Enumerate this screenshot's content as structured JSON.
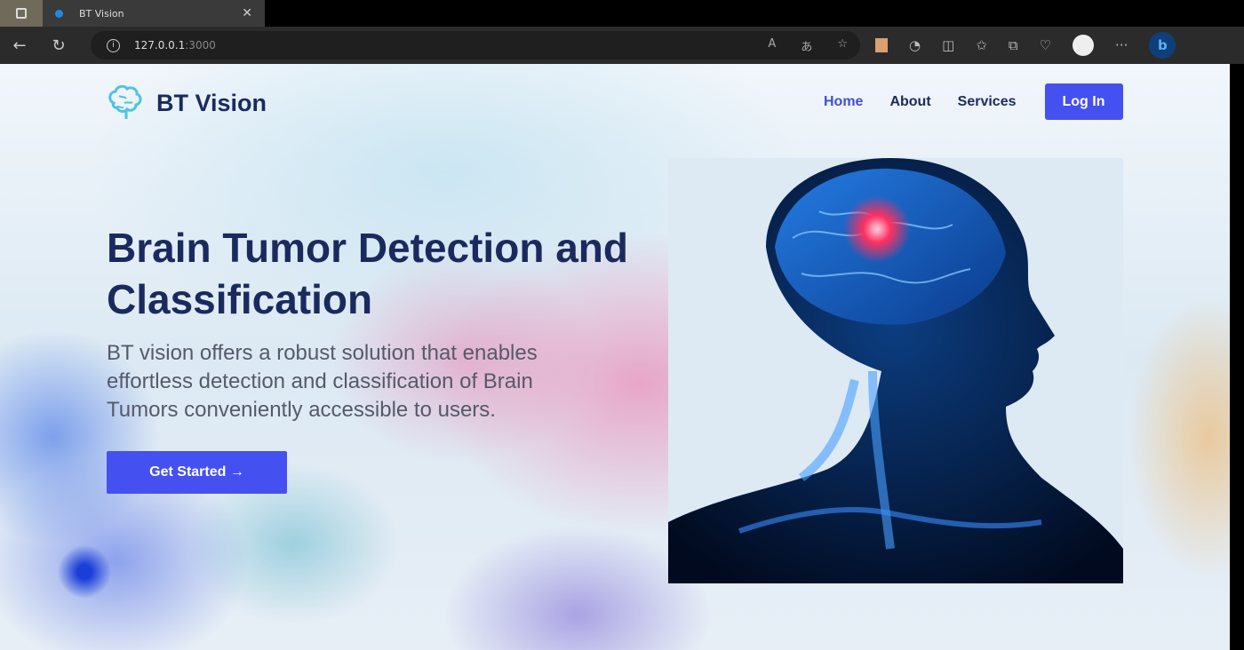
{
  "browser": {
    "tab_title": "BT Vision",
    "url_host": "127.0.0.1",
    "url_port": ":3000"
  },
  "site": {
    "brand": "BT Vision",
    "nav": [
      {
        "label": "Home",
        "active": true
      },
      {
        "label": "About"
      },
      {
        "label": "Services"
      }
    ],
    "login_label": "Log In",
    "hero": {
      "title": "Brain Tumor Detection and Classification",
      "description": "BT vision offers a robust solution that enables effortless detection and classification of Brain Tumors conveniently accessible to users.",
      "cta_label": "Get Started →"
    },
    "colors": {
      "primary": "#4450ef",
      "heading": "#1b2a5e"
    }
  }
}
